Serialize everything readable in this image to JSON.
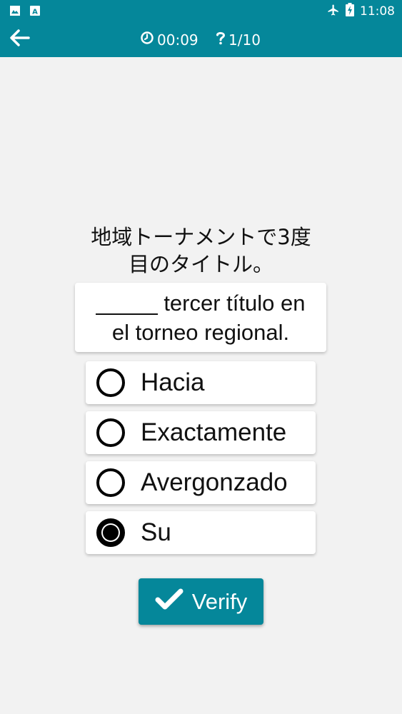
{
  "status_bar": {
    "time": "11:08",
    "icons": [
      "image-icon",
      "translate-icon",
      "airplane-mode-icon",
      "battery-icon"
    ]
  },
  "app_bar": {
    "back_icon": "back-arrow-icon",
    "timer_icon": "clock-icon",
    "timer": "00:09",
    "progress_icon": "question-mark-icon",
    "progress": "1/10"
  },
  "quiz": {
    "question_line1": "地域トーナメントで3度",
    "question_line2": "目のタイトル。",
    "sentence_line1": "_____ tercer título en",
    "sentence_line2": "el torneo regional.",
    "options": [
      {
        "label": "Hacia",
        "selected": false
      },
      {
        "label": "Exactamente",
        "selected": false
      },
      {
        "label": "Avergonzado",
        "selected": false
      },
      {
        "label": "Su",
        "selected": true
      }
    ],
    "verify_label": "Verify",
    "verify_icon": "check-icon"
  },
  "colors": {
    "primary": "#05879a",
    "background": "#f2f2f2",
    "card": "#ffffff"
  }
}
